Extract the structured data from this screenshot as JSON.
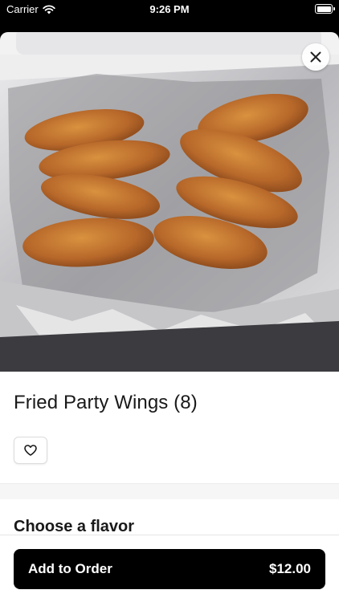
{
  "status_bar": {
    "carrier": "Carrier",
    "time": "9:26 PM"
  },
  "item": {
    "title": "Fried Party Wings (8)",
    "image_alt": "Fried chicken wings in a foil-lined takeout tray"
  },
  "options": {
    "section_title": "Choose a flavor"
  },
  "footer": {
    "button_label": "Add to Order",
    "price": "$12.00"
  },
  "colors": {
    "primary": "#000000",
    "text": "#191919",
    "sheet": "#ffffff",
    "band": "#f6f6f6"
  }
}
